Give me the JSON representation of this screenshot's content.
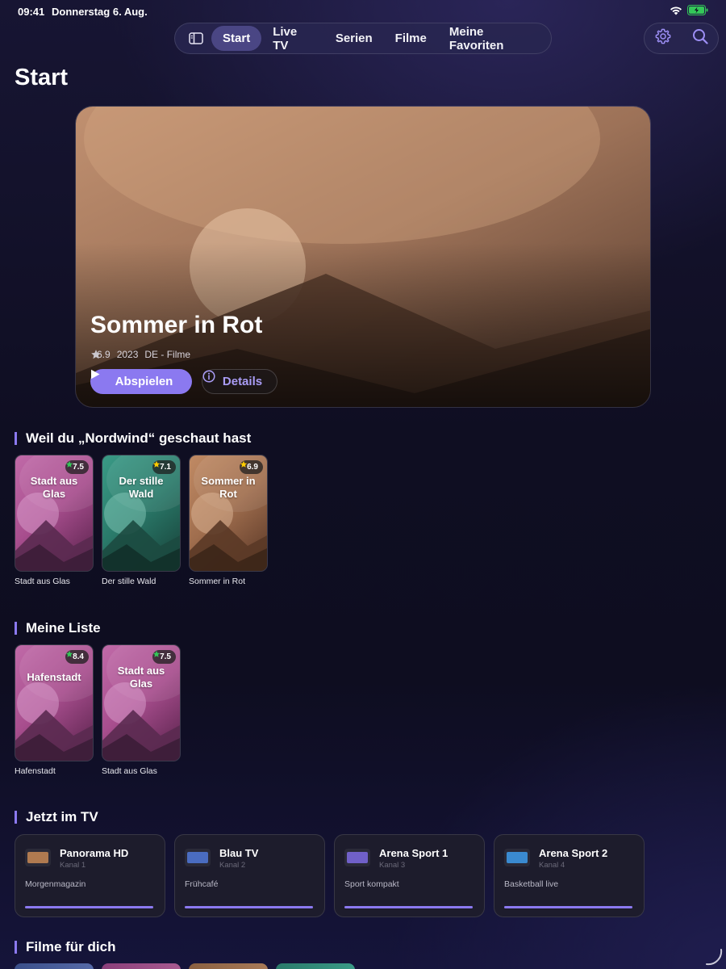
{
  "status": {
    "time": "09:41",
    "date": "Donnerstag 6. Aug."
  },
  "nav": {
    "tabs": [
      {
        "label": "Start",
        "active": true
      },
      {
        "label": "Live TV",
        "active": false
      },
      {
        "label": "Serien",
        "active": false
      },
      {
        "label": "Filme",
        "active": false
      },
      {
        "label": "Meine Favoriten",
        "active": false
      }
    ],
    "sidebar_icon": "sidebar-icon",
    "settings_icon": "gear-icon",
    "search_icon": "search-icon"
  },
  "page": {
    "title": "Start"
  },
  "hero": {
    "title": "Sommer in Rot",
    "rating": "6.9",
    "year": "2023",
    "category": "DE - Filme",
    "play_label": "Abspielen",
    "details_label": "Details"
  },
  "sections": {
    "because": {
      "title": "Weil du „Nordwind“ geschaut hast",
      "items": [
        {
          "title": "Stadt aus Glas",
          "rating": "7.5",
          "theme": "pink"
        },
        {
          "title": "Der stille Wald",
          "rating": "7.1",
          "theme": "teal"
        },
        {
          "title": "Sommer in Rot",
          "rating": "6.9",
          "theme": "amber"
        }
      ]
    },
    "mylist": {
      "title": "Meine Liste",
      "items": [
        {
          "title": "Hafenstadt",
          "rating": "8.4",
          "theme": "pink"
        },
        {
          "title": "Stadt aus Glas",
          "rating": "7.5",
          "theme": "pink"
        }
      ]
    },
    "livetv": {
      "title": "Jetzt im TV",
      "channels": [
        {
          "name": "Panorama HD",
          "channel": "Kanal 1",
          "show": "Morgenmagazin",
          "progress": 1.0,
          "logo_color": "#b07a50"
        },
        {
          "name": "Blau TV",
          "channel": "Kanal 2",
          "show": "Frühcafé",
          "progress": 1.0,
          "logo_color": "#4a6cc0"
        },
        {
          "name": "Arena Sport 1",
          "channel": "Kanal 3",
          "show": "Sport kompakt",
          "progress": 1.0,
          "logo_color": "#7060c8"
        },
        {
          "name": "Arena Sport 2",
          "channel": "Kanal 4",
          "show": "Basketball live",
          "progress": 1.0,
          "logo_color": "#3a8ad0"
        }
      ]
    },
    "movies": {
      "title": "Filme für dich"
    }
  },
  "colors": {
    "accent": "#8b79f0",
    "star_green": "#34c759",
    "star_yellow": "#ffcc00"
  }
}
